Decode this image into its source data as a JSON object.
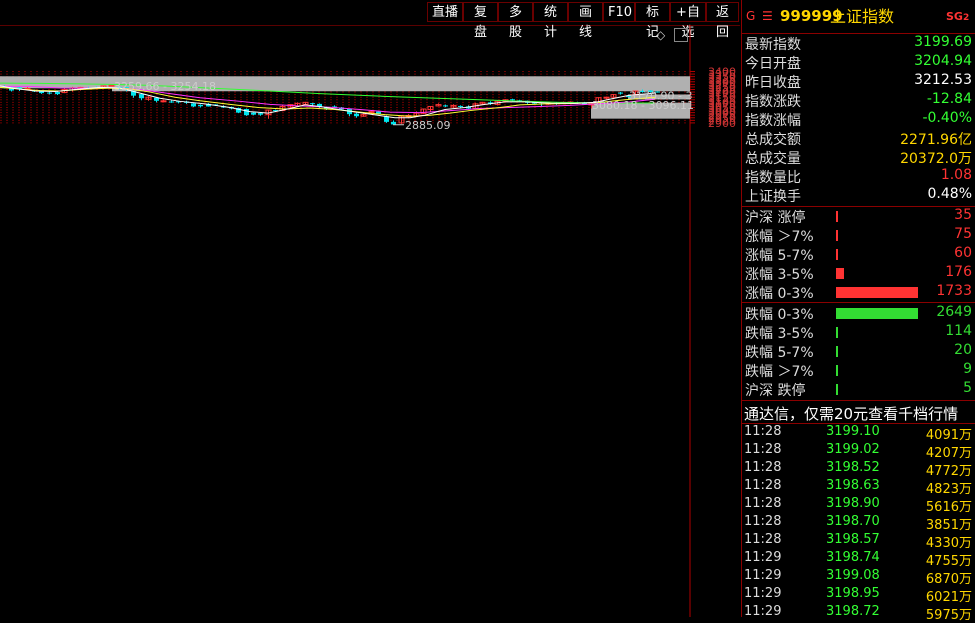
{
  "toolbar": {
    "buttons": [
      "直播",
      "复盘",
      "多股",
      "统计",
      "画线",
      "F10",
      "标记",
      "+自选",
      "返回"
    ]
  },
  "chart": {
    "y_labels": [
      "3400",
      "3375",
      "3350",
      "3325",
      "3300",
      "3275",
      "3250",
      "3225",
      "3200",
      "3175",
      "3150",
      "3125",
      "3100",
      "3075",
      "3050",
      "3025",
      "3000",
      "2975",
      "2950",
      "2925",
      "2900"
    ],
    "annotations": {
      "high": "3259.66 - 3254.18",
      "mid": "3170.90 - 3",
      "gap": "3080.18 - 3096.11",
      "low": "2885.09"
    },
    "colors": {
      "up": "#ff3333",
      "down": "#00e5ee",
      "ma5": "#ffffff",
      "ma10": "#ffff33",
      "ma20": "#ff33ff",
      "ma60": "#33ff33"
    }
  },
  "panel": {
    "code_prefix": "G",
    "menu_glyph": "☰",
    "code": "999999",
    "name": "上证指数",
    "badge": "SG",
    "badge_num": "2",
    "quote": [
      {
        "label": "最新指数",
        "value": "3199.69",
        "color": "#33ff33"
      },
      {
        "label": "今日开盘",
        "value": "3204.94",
        "color": "#33ff33"
      },
      {
        "label": "昨日收盘",
        "value": "3212.53",
        "color": "#ffffff"
      },
      {
        "label": "指数涨跌",
        "value": "-12.84",
        "color": "#33ff33"
      },
      {
        "label": "指数涨幅",
        "value": "-0.40%",
        "color": "#33ff33"
      },
      {
        "label": "总成交额",
        "value": "2271.96亿",
        "color": "#ffd700"
      },
      {
        "label": "总成交量",
        "value": "20372.0万",
        "color": "#ffd700"
      },
      {
        "label": "指数量比",
        "value": "1.08",
        "color": "#ff3333"
      },
      {
        "label": "上证换手",
        "value": "0.48%",
        "color": "#ffffff"
      }
    ],
    "breadth_up": [
      {
        "label": "沪深 涨停",
        "value": "35",
        "bar": 0.004
      },
      {
        "label": "涨幅 ＞7%",
        "value": "75",
        "bar": 0.009
      },
      {
        "label": "涨幅 5-7%",
        "value": "60",
        "bar": 0.007
      },
      {
        "label": "涨幅 3-5%",
        "value": "176",
        "bar": 0.1
      },
      {
        "label": "涨幅 0-3%",
        "value": "1733",
        "bar": 1.0
      }
    ],
    "breadth_down": [
      {
        "label": "跌幅 0-3%",
        "value": "2649",
        "bar": 1.0
      },
      {
        "label": "跌幅 3-5%",
        "value": "114",
        "bar": 0.02
      },
      {
        "label": "跌幅 5-7%",
        "value": "20",
        "bar": 0.004
      },
      {
        "label": "跌幅 ＞7%",
        "value": "9",
        "bar": 0.002
      },
      {
        "label": "沪深 跌停",
        "value": "5",
        "bar": 0.002
      }
    ],
    "promo": "通达信，仅需20元查看千档行情",
    "ticks": [
      {
        "time": "11:28",
        "price": "3199.10",
        "vol": "4091万"
      },
      {
        "time": "11:28",
        "price": "3199.02",
        "vol": "4207万"
      },
      {
        "time": "11:28",
        "price": "3198.52",
        "vol": "4772万"
      },
      {
        "time": "11:28",
        "price": "3198.63",
        "vol": "4823万"
      },
      {
        "time": "11:28",
        "price": "3198.90",
        "vol": "5616万"
      },
      {
        "time": "11:28",
        "price": "3198.70",
        "vol": "3851万"
      },
      {
        "time": "11:28",
        "price": "3198.57",
        "vol": "4330万"
      },
      {
        "time": "11:29",
        "price": "3198.74",
        "vol": "4755万"
      },
      {
        "time": "11:29",
        "price": "3199.08",
        "vol": "6870万"
      },
      {
        "time": "11:29",
        "price": "3198.95",
        "vol": "6021万"
      },
      {
        "time": "11:29",
        "price": "3198.72",
        "vol": "5975万"
      }
    ]
  }
}
